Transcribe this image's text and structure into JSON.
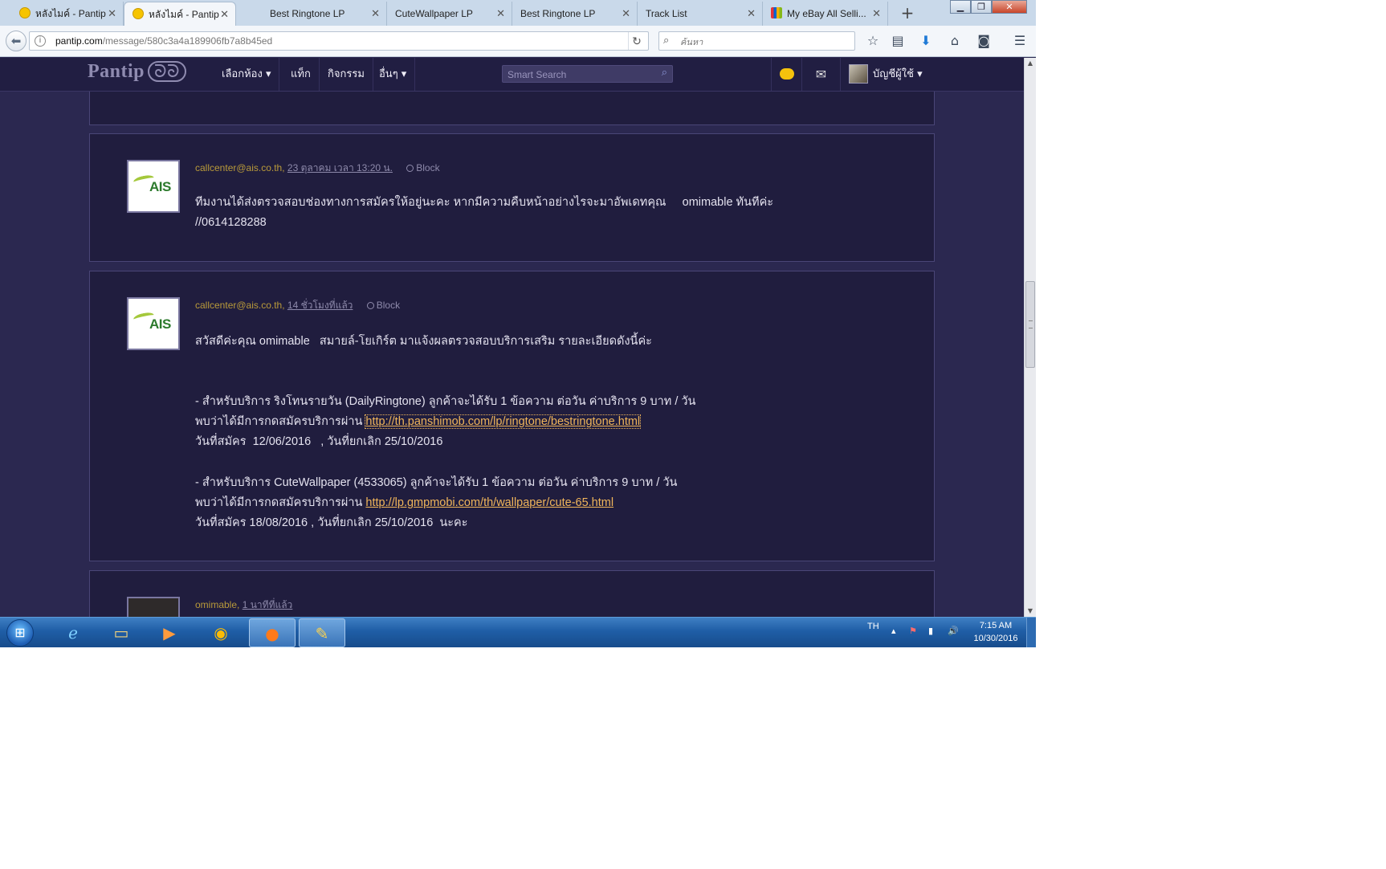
{
  "browser": {
    "tabs": [
      {
        "label": "หลังไมค์ - Pantip",
        "favicon": "pantip-icon",
        "active": false
      },
      {
        "label": "หลังไมค์ - Pantip",
        "favicon": "pantip-icon",
        "active": true
      },
      {
        "label": "Best Ringtone LP",
        "favicon": "",
        "active": false
      },
      {
        "label": "CuteWallpaper LP",
        "favicon": "",
        "active": false
      },
      {
        "label": "Best Ringtone LP",
        "favicon": "",
        "active": false
      },
      {
        "label": "Track List",
        "favicon": "",
        "active": false
      },
      {
        "label": "My eBay All Selli...",
        "favicon": "ebay-icon",
        "active": false
      }
    ],
    "url_host": "pantip.com",
    "url_path": "/message/580c3a4a189906fb7a8b45ed",
    "search_placeholder": "ค้นหา"
  },
  "site": {
    "logo": "Pantip",
    "logo_mark": "ᘐᘐ",
    "nav": [
      "เลือกห้อง ▾",
      "แท็ก",
      "กิจกรรม",
      "อื่นๆ ▾"
    ],
    "smart_search_placeholder": "Smart Search",
    "account_label": "บัญชีผู้ใช้ ▾"
  },
  "posts": [
    {
      "author": "callcenter@ais.co.th",
      "time": "23 ตุลาคม เวลา 13:20 น.",
      "block_label": "Block",
      "lines": [
        "ทีมงานได้ส่งตรวจสอบช่องทางการสมัครให้อยู่นะคะ หากมีความคืบหน้าอย่างไรจะมาอัพเดทคุณ     omimable ทันทีค่ะ",
        "//0614128288"
      ]
    },
    {
      "author": "callcenter@ais.co.th",
      "time": "14 ชั่วโมงที่แล้ว",
      "block_label": "Block",
      "greeting": "สวัสดีค่ะคุณ omimable   สมายล์-โยเกิร์ต มาแจ้งผลตรวจสอบบริการเสริม รายละเอียดดังนี้ค่ะ",
      "item1_line1": "- สำหรับบริการ ริงโทนรายวัน (DailyRingtone) ลูกค้าจะได้รับ 1 ข้อความ ต่อวัน ค่าบริการ 9 บาท / วัน",
      "item1_line2_prefix": "พบว่าได้มีการกดสมัครบริการผ่าน ",
      "item1_link": "http://th.panshimob.com/lp/ringtone/bestringtone.html",
      "item1_line3": "วันที่สมัคร  12/06/2016   , วันที่ยกเลิก 25/10/2016",
      "item2_line1": "- สำหรับบริการ CuteWallpaper (4533065) ลูกค้าจะได้รับ 1 ข้อความ ต่อวัน ค่าบริการ 9 บาท / วัน",
      "item2_line2_prefix": "พบว่าได้มีการกดสมัครบริการผ่าน ",
      "item2_link": "http://lp.gmpmobi.com/th/wallpaper/cute-65.html",
      "item2_line3": "วันที่สมัคร 18/08/2016 , วันที่ยกเลิก 25/10/2016  นะคะ"
    },
    {
      "author": "omimable",
      "time": "1 นาทีที่แล้ว"
    }
  ],
  "taskbar": {
    "language": "TH",
    "time": "7:15 AM",
    "date": "10/30/2016"
  },
  "colors": {
    "page_bg": "#2b2850",
    "post_bg": "#201d3e",
    "author": "#b99a3a",
    "link": "#f0b55a"
  }
}
